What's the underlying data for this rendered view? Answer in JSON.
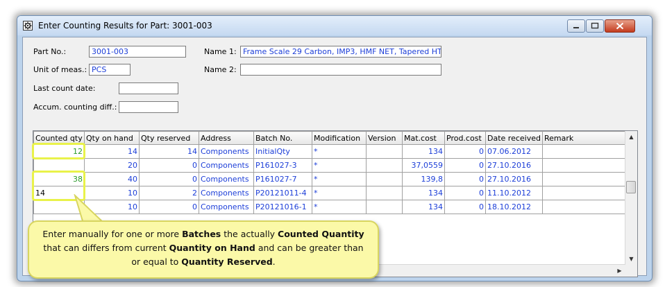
{
  "window": {
    "title": "Enter Counting Results for Part: 3001-003",
    "icon": "gear-icon"
  },
  "form": {
    "part_no_label": "Part No.:",
    "part_no_value": "3001-003",
    "unit_label": "Unit of meas.:",
    "unit_value": "PCS",
    "last_count_label": "Last count date:",
    "last_count_value": "",
    "accum_label": "Accum. counting diff.:",
    "accum_value": "",
    "name1_label": "Name 1:",
    "name1_value": "Frame Scale 29 Carbon, IMP3, HMF NET, Tapered HT",
    "name2_label": "Name 2:",
    "name2_value": ""
  },
  "grid": {
    "columns": [
      "Counted qty",
      "Qty on hand",
      "Qty reserved",
      "Address",
      "Batch No.",
      "Modification",
      "Version",
      "Mat.cost",
      "Prod.cost",
      "Date received",
      "Remark"
    ],
    "rows": [
      {
        "counted": "12",
        "on_hand": "14",
        "reserved": "14",
        "address": "Components",
        "batch": "InitialQty",
        "mod": "*",
        "version": "",
        "mat_cost": "134",
        "prod_cost": "0",
        "date": "07.06.2012",
        "remark": ""
      },
      {
        "counted": "",
        "on_hand": "20",
        "reserved": "0",
        "address": "Components",
        "batch": "P161027-3",
        "mod": "*",
        "version": "",
        "mat_cost": "37,0559",
        "prod_cost": "0",
        "date": "27.10.2016",
        "remark": ""
      },
      {
        "counted": "38",
        "on_hand": "40",
        "reserved": "0",
        "address": "Components",
        "batch": "P161027-7",
        "mod": "*",
        "version": "",
        "mat_cost": "139,8",
        "prod_cost": "0",
        "date": "27.10.2016",
        "remark": ""
      },
      {
        "counted": "14",
        "on_hand": "10",
        "reserved": "2",
        "address": "Components",
        "batch": "P20121011-4",
        "mod": "*",
        "version": "",
        "mat_cost": "134",
        "prod_cost": "0",
        "date": "11.10.2012",
        "remark": ""
      },
      {
        "counted": "",
        "on_hand": "10",
        "reserved": "0",
        "address": "Components",
        "batch": "P20121016-1",
        "mod": "*",
        "version": "",
        "mat_cost": "134",
        "prod_cost": "0",
        "date": "18.10.2012",
        "remark": ""
      }
    ]
  },
  "callout": {
    "t1": "Enter manually for one or more ",
    "b1": "Batches",
    "t2": " the actually ",
    "b2": "Counted Quantity",
    "t3": " that can differs from current ",
    "b3": "Quantity on Hand",
    "t4": " and can be greater than or equal to ",
    "b4": "Quantity Reserved",
    "t5": "."
  },
  "colors": {
    "highlight": "#e9f24a",
    "callout_bg": "#fbf9a8",
    "value_text": "#1c3ed8",
    "counted_text": "#2b9b2b"
  }
}
